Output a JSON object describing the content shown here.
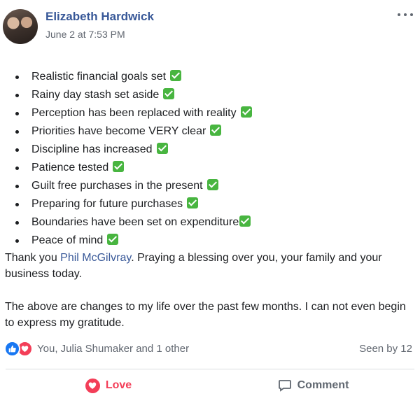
{
  "post": {
    "author": "Elizabeth Hardwick",
    "timestamp": "June 2 at 7:53 PM",
    "list_items": [
      "Realistic financial goals set",
      "Rainy day stash set aside",
      "Perception has been replaced with reality",
      "Priorities have become VERY clear",
      "Discipline has increased",
      "Patience tested",
      "Guilt free purchases in the present",
      "Preparing for future purchases",
      "Boundaries have been set on expenditure",
      "Peace of mind"
    ],
    "paragraph1": {
      "prefix": "Thank you ",
      "mention": "Phil McGilvray",
      "suffix": ". Praying a blessing over you, your family and your business today."
    },
    "paragraph2": "The above are changes to my life over the past few months. I can not even begin to express my gratitude."
  },
  "reactions": {
    "summary": "You, Julia Shumaker and 1 other",
    "seen_by": "Seen by 12"
  },
  "actions": {
    "love_label": "Love",
    "comment_label": "Comment"
  },
  "icons": {
    "checkmark": "white-check-mark-emoji",
    "like": "thumbs-up-icon",
    "love": "heart-icon",
    "comment": "speech-bubble-icon",
    "more": "ellipsis-icon"
  },
  "colors": {
    "link": "#385898",
    "secondary_text": "#616770",
    "like_blue": "#1877f2",
    "love_red": "#f33e58",
    "check_green": "#48b540"
  }
}
